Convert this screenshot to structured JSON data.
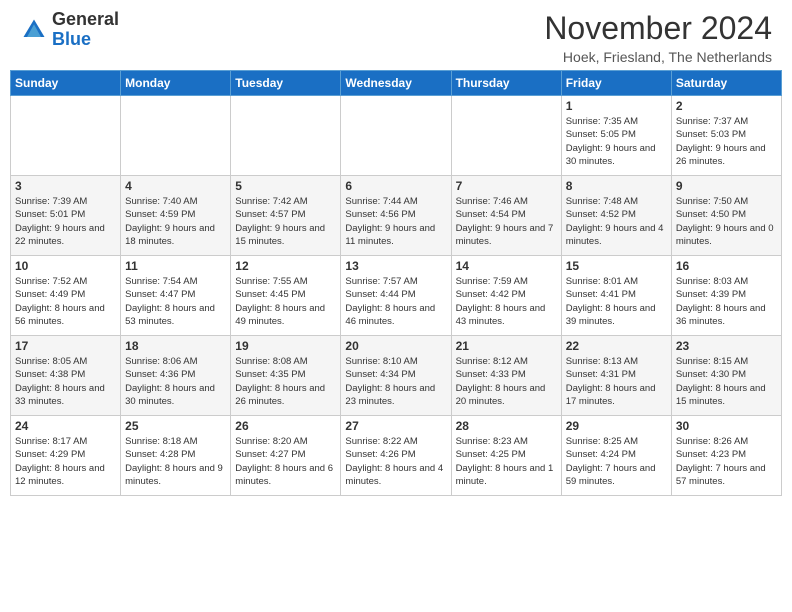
{
  "header": {
    "logo_line1": "General",
    "logo_line2": "Blue",
    "month_title": "November 2024",
    "location": "Hoek, Friesland, The Netherlands"
  },
  "weekdays": [
    "Sunday",
    "Monday",
    "Tuesday",
    "Wednesday",
    "Thursday",
    "Friday",
    "Saturday"
  ],
  "weeks": [
    [
      {
        "day": "",
        "info": ""
      },
      {
        "day": "",
        "info": ""
      },
      {
        "day": "",
        "info": ""
      },
      {
        "day": "",
        "info": ""
      },
      {
        "day": "",
        "info": ""
      },
      {
        "day": "1",
        "info": "Sunrise: 7:35 AM\nSunset: 5:05 PM\nDaylight: 9 hours and 30 minutes."
      },
      {
        "day": "2",
        "info": "Sunrise: 7:37 AM\nSunset: 5:03 PM\nDaylight: 9 hours and 26 minutes."
      }
    ],
    [
      {
        "day": "3",
        "info": "Sunrise: 7:39 AM\nSunset: 5:01 PM\nDaylight: 9 hours and 22 minutes."
      },
      {
        "day": "4",
        "info": "Sunrise: 7:40 AM\nSunset: 4:59 PM\nDaylight: 9 hours and 18 minutes."
      },
      {
        "day": "5",
        "info": "Sunrise: 7:42 AM\nSunset: 4:57 PM\nDaylight: 9 hours and 15 minutes."
      },
      {
        "day": "6",
        "info": "Sunrise: 7:44 AM\nSunset: 4:56 PM\nDaylight: 9 hours and 11 minutes."
      },
      {
        "day": "7",
        "info": "Sunrise: 7:46 AM\nSunset: 4:54 PM\nDaylight: 9 hours and 7 minutes."
      },
      {
        "day": "8",
        "info": "Sunrise: 7:48 AM\nSunset: 4:52 PM\nDaylight: 9 hours and 4 minutes."
      },
      {
        "day": "9",
        "info": "Sunrise: 7:50 AM\nSunset: 4:50 PM\nDaylight: 9 hours and 0 minutes."
      }
    ],
    [
      {
        "day": "10",
        "info": "Sunrise: 7:52 AM\nSunset: 4:49 PM\nDaylight: 8 hours and 56 minutes."
      },
      {
        "day": "11",
        "info": "Sunrise: 7:54 AM\nSunset: 4:47 PM\nDaylight: 8 hours and 53 minutes."
      },
      {
        "day": "12",
        "info": "Sunrise: 7:55 AM\nSunset: 4:45 PM\nDaylight: 8 hours and 49 minutes."
      },
      {
        "day": "13",
        "info": "Sunrise: 7:57 AM\nSunset: 4:44 PM\nDaylight: 8 hours and 46 minutes."
      },
      {
        "day": "14",
        "info": "Sunrise: 7:59 AM\nSunset: 4:42 PM\nDaylight: 8 hours and 43 minutes."
      },
      {
        "day": "15",
        "info": "Sunrise: 8:01 AM\nSunset: 4:41 PM\nDaylight: 8 hours and 39 minutes."
      },
      {
        "day": "16",
        "info": "Sunrise: 8:03 AM\nSunset: 4:39 PM\nDaylight: 8 hours and 36 minutes."
      }
    ],
    [
      {
        "day": "17",
        "info": "Sunrise: 8:05 AM\nSunset: 4:38 PM\nDaylight: 8 hours and 33 minutes."
      },
      {
        "day": "18",
        "info": "Sunrise: 8:06 AM\nSunset: 4:36 PM\nDaylight: 8 hours and 30 minutes."
      },
      {
        "day": "19",
        "info": "Sunrise: 8:08 AM\nSunset: 4:35 PM\nDaylight: 8 hours and 26 minutes."
      },
      {
        "day": "20",
        "info": "Sunrise: 8:10 AM\nSunset: 4:34 PM\nDaylight: 8 hours and 23 minutes."
      },
      {
        "day": "21",
        "info": "Sunrise: 8:12 AM\nSunset: 4:33 PM\nDaylight: 8 hours and 20 minutes."
      },
      {
        "day": "22",
        "info": "Sunrise: 8:13 AM\nSunset: 4:31 PM\nDaylight: 8 hours and 17 minutes."
      },
      {
        "day": "23",
        "info": "Sunrise: 8:15 AM\nSunset: 4:30 PM\nDaylight: 8 hours and 15 minutes."
      }
    ],
    [
      {
        "day": "24",
        "info": "Sunrise: 8:17 AM\nSunset: 4:29 PM\nDaylight: 8 hours and 12 minutes."
      },
      {
        "day": "25",
        "info": "Sunrise: 8:18 AM\nSunset: 4:28 PM\nDaylight: 8 hours and 9 minutes."
      },
      {
        "day": "26",
        "info": "Sunrise: 8:20 AM\nSunset: 4:27 PM\nDaylight: 8 hours and 6 minutes."
      },
      {
        "day": "27",
        "info": "Sunrise: 8:22 AM\nSunset: 4:26 PM\nDaylight: 8 hours and 4 minutes."
      },
      {
        "day": "28",
        "info": "Sunrise: 8:23 AM\nSunset: 4:25 PM\nDaylight: 8 hours and 1 minute."
      },
      {
        "day": "29",
        "info": "Sunrise: 8:25 AM\nSunset: 4:24 PM\nDaylight: 7 hours and 59 minutes."
      },
      {
        "day": "30",
        "info": "Sunrise: 8:26 AM\nSunset: 4:23 PM\nDaylight: 7 hours and 57 minutes."
      }
    ]
  ]
}
